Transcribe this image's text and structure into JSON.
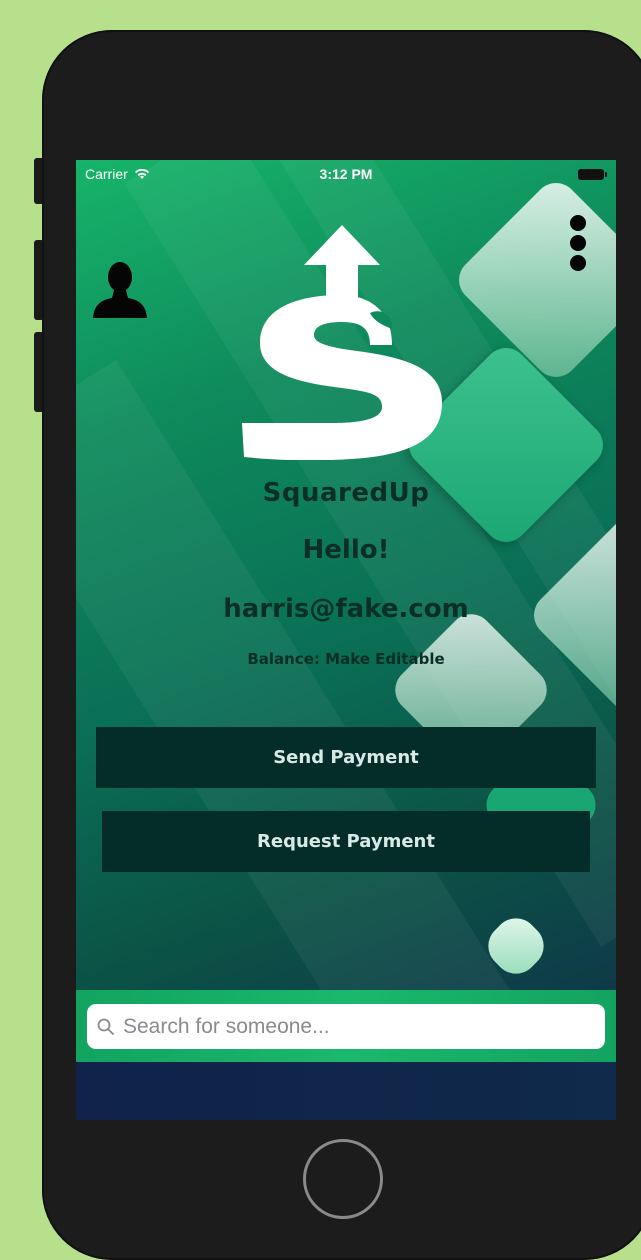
{
  "status_bar": {
    "carrier": "Carrier",
    "time": "3:12 PM"
  },
  "app": {
    "brand": "SquaredUp",
    "greeting": "Hello!",
    "email": "harris@fake.com",
    "balance": "Balance: Make Editable"
  },
  "actions": {
    "send_label": "Send Payment",
    "request_label": "Request Payment"
  },
  "search": {
    "placeholder": "Search for someone..."
  },
  "icons": {
    "profile": "person-icon",
    "menu": "more-vertical-icon",
    "search": "search-icon",
    "wifi": "wifi-icon",
    "battery": "battery-icon",
    "logo": "dollar-arrow-logo"
  },
  "colors": {
    "page_background": "#b7e08c",
    "button_background": "#042d2a",
    "button_text": "#d9e9e6",
    "heading_text": "#0b2e26"
  }
}
